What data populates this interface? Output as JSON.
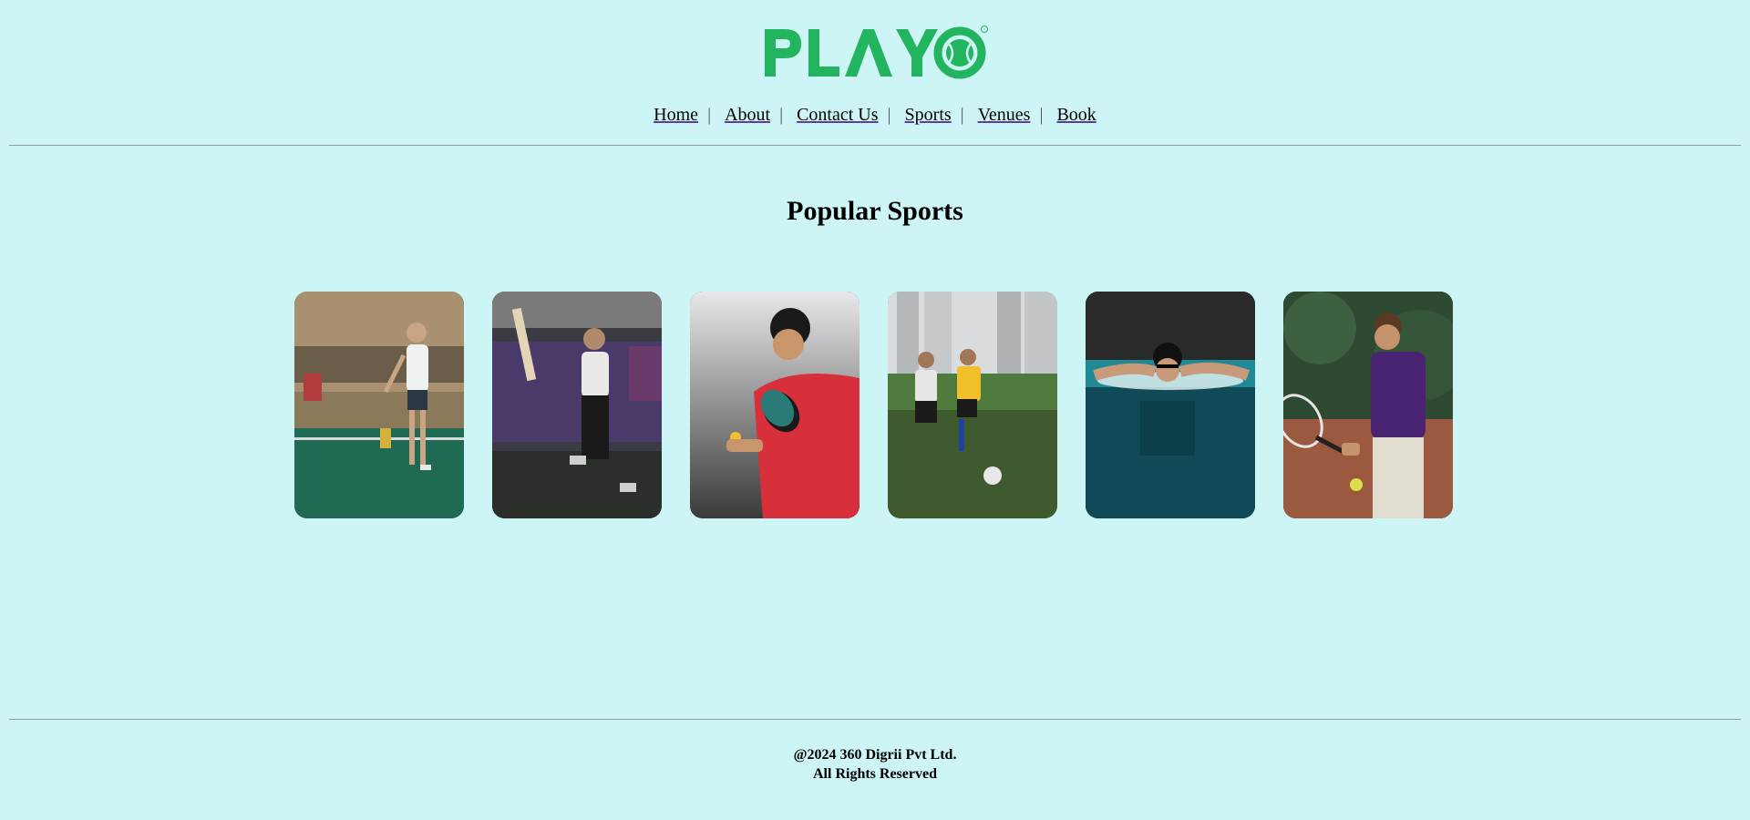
{
  "brand": {
    "logo_text": "PLAYO",
    "registered_mark": "®",
    "color": "#23b45f"
  },
  "nav": {
    "items": [
      {
        "label": "Home"
      },
      {
        "label": "About"
      },
      {
        "label": "Contact Us"
      },
      {
        "label": "Sports"
      },
      {
        "label": "Venues"
      },
      {
        "label": "Book"
      }
    ],
    "separator": "|"
  },
  "main": {
    "heading": "Popular Sports",
    "sports": [
      {
        "icon": "badminton-player-photo"
      },
      {
        "icon": "cricket-player-photo"
      },
      {
        "icon": "table-tennis-player-photo"
      },
      {
        "icon": "football-players-photo"
      },
      {
        "icon": "swimmer-photo"
      },
      {
        "icon": "tennis-player-photo"
      }
    ]
  },
  "footer": {
    "line1": "@2024 360 Digrii Pvt Ltd.",
    "line2": "All Rights Reserved"
  },
  "colors": {
    "background": "#cdf5f5",
    "divider": "#9a9a9a"
  }
}
